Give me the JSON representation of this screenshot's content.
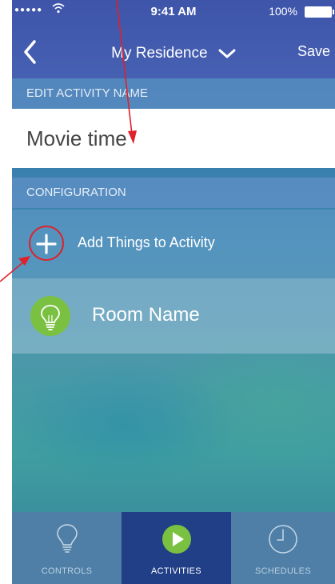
{
  "status": {
    "time": "9:41 AM",
    "battery": "100%"
  },
  "nav": {
    "title": "My Residence",
    "save_label": "Save"
  },
  "edit_section": {
    "header": "EDIT ACTIVITY NAME",
    "value": "Movie time"
  },
  "config_section": {
    "header": "CONFIGURATION",
    "add_label": "Add Things to Activity",
    "room_label": "Room Name"
  },
  "tabs": [
    {
      "label": "CONTROLS",
      "icon": "lightbulb-icon",
      "active": false
    },
    {
      "label": "ACTIVITIES",
      "icon": "play-icon",
      "active": true
    },
    {
      "label": "SCHEDULES",
      "icon": "clock-icon",
      "active": false
    }
  ],
  "colors": {
    "header": "#4660b2",
    "accent_green": "#7ac142",
    "active_tab": "#203f86",
    "annotation_red": "#e0202a"
  }
}
